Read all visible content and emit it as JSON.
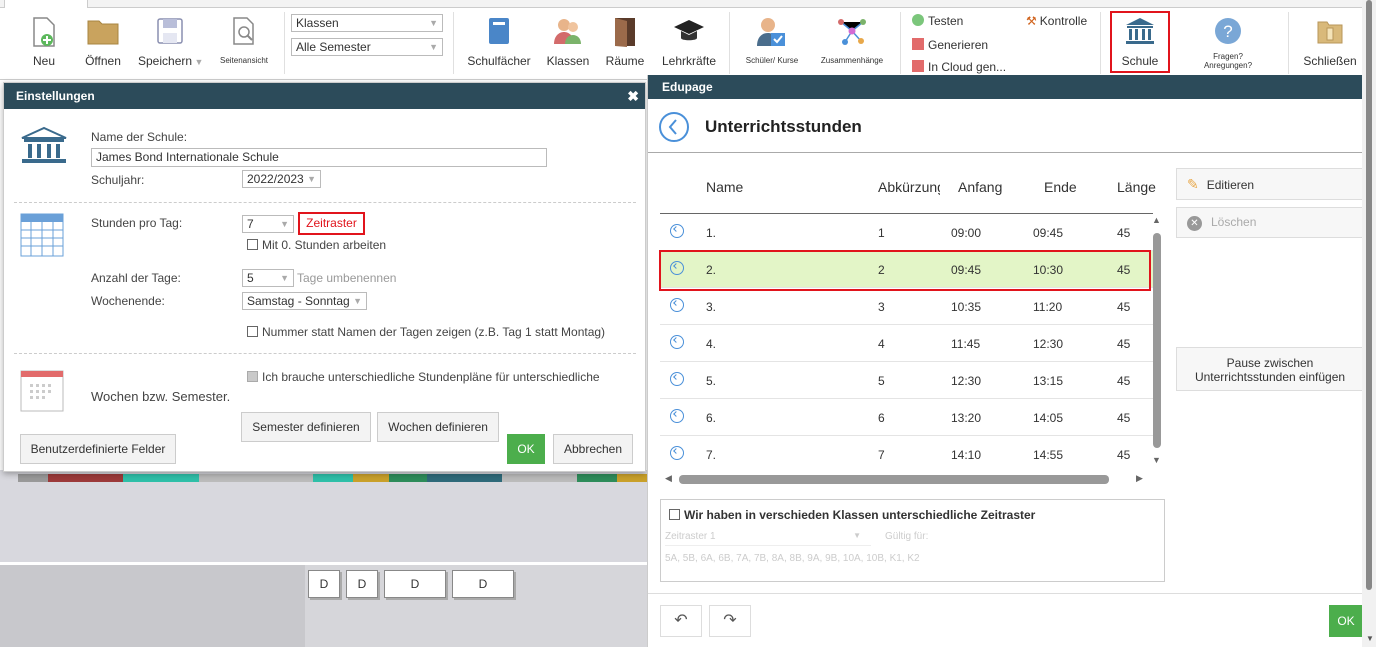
{
  "toolbar": {
    "neu": "Neu",
    "oeffnen": "Öffnen",
    "speichern": "Speichern",
    "seitenansicht": "Seitenansicht",
    "klassen_select": "Klassen",
    "semester_select": "Alle Semester",
    "schulfaecher": "Schulfächer",
    "klassen": "Klassen",
    "raeume": "Räume",
    "lehrkraefte": "Lehrkräfte",
    "schueler_kurse": "Schüler/ Kurse",
    "zusammenhaenge": "Zusammenhänge",
    "testen": "Testen",
    "kontrolle": "Kontrolle",
    "generieren": "Generieren",
    "in_cloud": "In Cloud gen...",
    "schule": "Schule",
    "fragen_1": "Fragen?",
    "fragen_2": "Anregungen?",
    "schliessen": "Schließen"
  },
  "einstellungen": {
    "title": "Einstellungen",
    "name_label": "Name der Schule:",
    "name_value": "James Bond Internationale Schule",
    "schuljahr_label": "Schuljahr:",
    "schuljahr_value": "2022/2023",
    "stunden_label": "Stunden pro Tag:",
    "stunden_value": "7",
    "zeitraster": "Zeitraster",
    "mit0": "Mit 0. Stunden arbeiten",
    "tage_label": "Anzahl der Tage:",
    "tage_value": "5",
    "tage_umbenennen": "Tage umbenennen",
    "wochenende_label": "Wochenende:",
    "wochenende_value": "Samstag - Sonntag",
    "nummer_statt": "Nummer statt Namen der Tagen zeigen (z.B. Tag 1 statt Montag)",
    "unterschiedlich": "Ich brauche unterschiedliche Stundenpläne für unterschiedliche",
    "wochen_semester": "Wochen bzw. Semester.",
    "semester_definieren": "Semester definieren",
    "wochen_definieren": "Wochen definieren",
    "benutzerdefinierte": "Benutzerdefinierte Felder",
    "ok": "OK",
    "abbrechen": "Abbrechen"
  },
  "edupage": {
    "header": "Edupage",
    "title": "Unterrichtsstunden",
    "columns": [
      "Name",
      "Abkürzung",
      "Anfang",
      "Ende",
      "Länge"
    ],
    "rows": [
      {
        "name": "1.",
        "abk": "1",
        "anfang": "09:00",
        "ende": "09:45",
        "laenge": "45"
      },
      {
        "name": "2.",
        "abk": "2",
        "anfang": "09:45",
        "ende": "10:30",
        "laenge": "45"
      },
      {
        "name": "3.",
        "abk": "3",
        "anfang": "10:35",
        "ende": "11:20",
        "laenge": "45"
      },
      {
        "name": "4.",
        "abk": "4",
        "anfang": "11:45",
        "ende": "12:30",
        "laenge": "45"
      },
      {
        "name": "5.",
        "abk": "5",
        "anfang": "12:30",
        "ende": "13:15",
        "laenge": "45"
      },
      {
        "name": "6.",
        "abk": "6",
        "anfang": "13:20",
        "ende": "14:05",
        "laenge": "45"
      },
      {
        "name": "7.",
        "abk": "7",
        "anfang": "14:10",
        "ende": "14:55",
        "laenge": "45"
      }
    ],
    "editieren": "Editieren",
    "loeschen": "Löschen",
    "pause_1": "Pause zwischen",
    "pause_2": "Unterrichtsstunden einfügen",
    "verschieden": "Wir haben in verschieden Klassen unterschiedliche Zeitraster",
    "zeitraster_select": "Zeitraster 1",
    "gueltig": "Gültig für:",
    "klassen_list": "5A, 5B, 6A, 6B, 7A, 7B, 8A, 8B, 9A, 9B, 10A, 10B, K1, K2",
    "ok": "OK"
  },
  "background": {
    "cards": [
      "D",
      "D",
      "D",
      "D"
    ]
  },
  "colors": {
    "header_bg": "#2c4b5a",
    "highlight_red": "#e1141c",
    "ok_green": "#4cae4c",
    "selected_row": "#e3f5c7"
  }
}
